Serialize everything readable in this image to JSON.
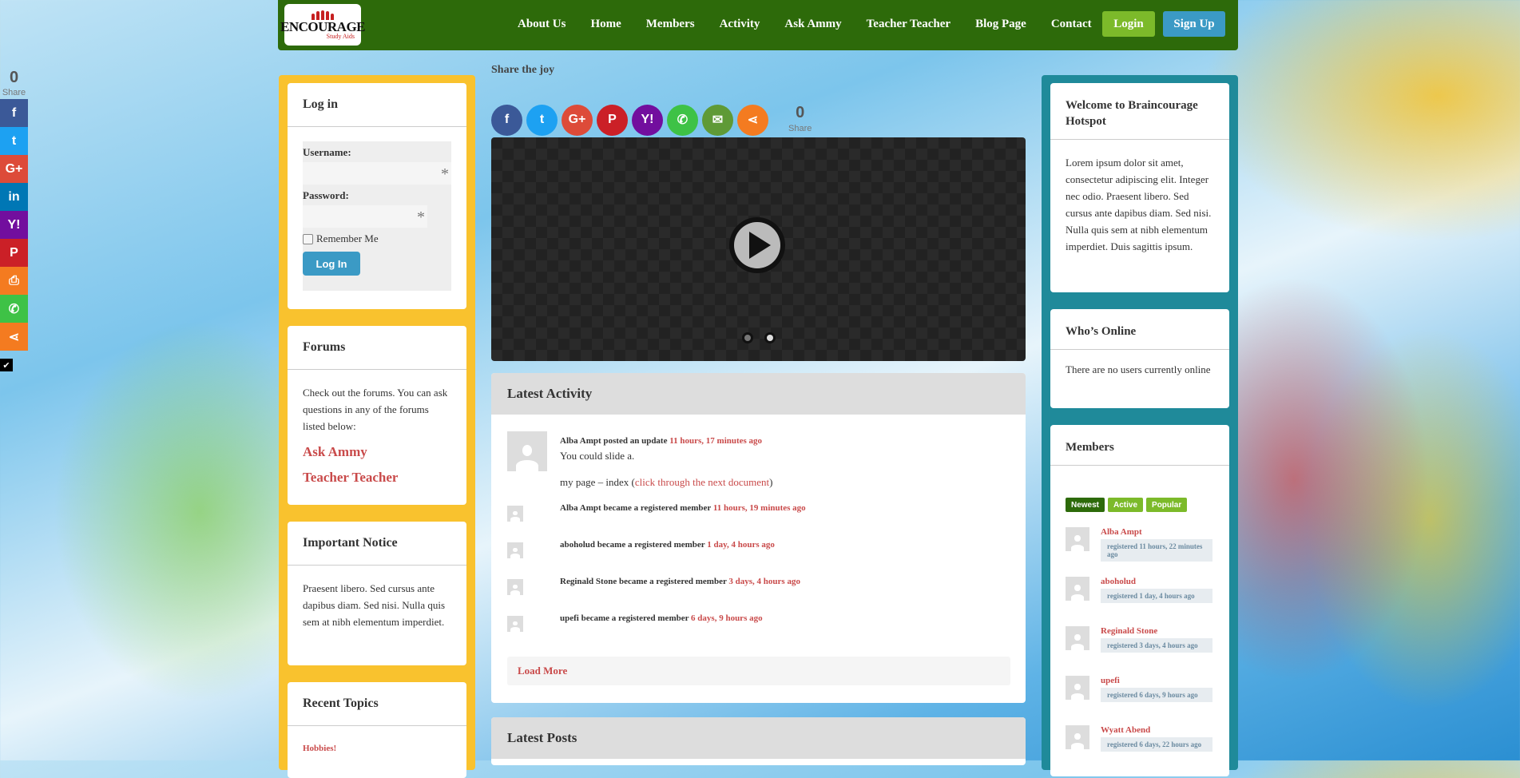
{
  "side_share": {
    "count": "0",
    "count_label": "Share",
    "buttons": [
      {
        "name": "facebook",
        "glyph": "f",
        "color": "#3b5998"
      },
      {
        "name": "twitter",
        "glyph": "t",
        "color": "#1da1f2"
      },
      {
        "name": "google-plus",
        "glyph": "G+",
        "color": "#dd4b39"
      },
      {
        "name": "linkedin",
        "glyph": "in",
        "color": "#0077b5"
      },
      {
        "name": "yahoo",
        "glyph": "Y!",
        "color": "#720e9e"
      },
      {
        "name": "pinterest",
        "glyph": "P",
        "color": "#cb2027"
      },
      {
        "name": "print",
        "glyph": "⎙",
        "color": "#f47b20"
      },
      {
        "name": "whatsapp",
        "glyph": "✆",
        "color": "#3ec246"
      },
      {
        "name": "share",
        "glyph": "⋖",
        "color": "#f47b20"
      }
    ],
    "hide_glyph": "✔"
  },
  "header": {
    "logo_top": "ENCOURAGE",
    "logo_bottom": "Study Aids",
    "nav": [
      "About Us",
      "Home",
      "Members",
      "Activity",
      "Ask Ammy",
      "Teacher Teacher",
      "Blog Page",
      "Contact"
    ],
    "login_label": "Login",
    "signup_label": "Sign Up"
  },
  "left": {
    "login": {
      "title": "Log in",
      "username_label": "Username:",
      "password_label": "Password:",
      "required_mark": "*",
      "remember_label": "Remember Me",
      "button": "Log In"
    },
    "forums": {
      "title": "Forums",
      "text": "Check out the forums. You can ask questions in any of the forums listed below:",
      "links": [
        "Ask Ammy",
        "Teacher Teacher"
      ]
    },
    "notice": {
      "title": "Important Notice",
      "text": "Praesent libero. Sed cursus ante dapibus diam. Sed nisi. Nulla quis sem at nibh elementum imperdiet."
    },
    "recent": {
      "title": "Recent Topics",
      "first": "Hobbies!"
    }
  },
  "center": {
    "share_title": "Share the joy",
    "share_buttons": [
      {
        "name": "facebook",
        "glyph": "f",
        "color": "#3b5998"
      },
      {
        "name": "twitter",
        "glyph": "t",
        "color": "#1da1f2"
      },
      {
        "name": "google-plus",
        "glyph": "G+",
        "color": "#dd4b39"
      },
      {
        "name": "pinterest",
        "glyph": "P",
        "color": "#cb2027"
      },
      {
        "name": "yahoo",
        "glyph": "Y!",
        "color": "#720e9e"
      },
      {
        "name": "whatsapp",
        "glyph": "✆",
        "color": "#3ec246"
      },
      {
        "name": "email",
        "glyph": "✉",
        "color": "#5f9a36"
      },
      {
        "name": "share",
        "glyph": "⋖",
        "color": "#f47b20"
      }
    ],
    "share_count": "0",
    "share_count_label": "Share",
    "activity": {
      "title": "Latest Activity",
      "items": [
        {
          "who": "Alba Ampt posted an update",
          "time": "11 hours, 17 minutes ago",
          "body": "You could slide a.",
          "link_prefix": "my page – index (",
          "link_text": "click through the next document",
          "link_suffix": ")"
        },
        {
          "who": "Alba Ampt became a registered member",
          "time": "11 hours, 19 minutes ago"
        },
        {
          "who": "aboholud became a registered member",
          "time": "1 day, 4 hours ago"
        },
        {
          "who": "Reginald Stone became a registered member",
          "time": "3 days, 4 hours ago"
        },
        {
          "who": "upefi became a registered member",
          "time": "6 days, 9 hours ago"
        }
      ],
      "load_more": "Load More"
    },
    "posts": {
      "title": "Latest Posts"
    }
  },
  "right": {
    "welcome": {
      "title": "Welcome to Braincourage Hotspot",
      "text": "Lorem ipsum dolor sit amet, consectetur adipiscing elit. Integer nec odio. Praesent libero. Sed cursus ante dapibus diam. Sed nisi. Nulla quis sem at nibh elementum imperdiet. Duis sagittis ipsum."
    },
    "online": {
      "title": "Who’s Online",
      "text": "There are no users currently online"
    },
    "members": {
      "title": "Members",
      "tabs": [
        "Newest",
        "Active",
        "Popular"
      ],
      "list": [
        {
          "name": "Alba Ampt",
          "meta": "registered 11 hours, 22 minutes ago"
        },
        {
          "name": "aboholud",
          "meta": "registered 1 day, 4 hours ago"
        },
        {
          "name": "Reginald Stone",
          "meta": "registered 3 days, 4 hours ago"
        },
        {
          "name": "upefi",
          "meta": "registered 6 days, 9 hours ago"
        },
        {
          "name": "Wyatt Abend",
          "meta": "registered 6 days, 22 hours ago"
        }
      ]
    }
  }
}
